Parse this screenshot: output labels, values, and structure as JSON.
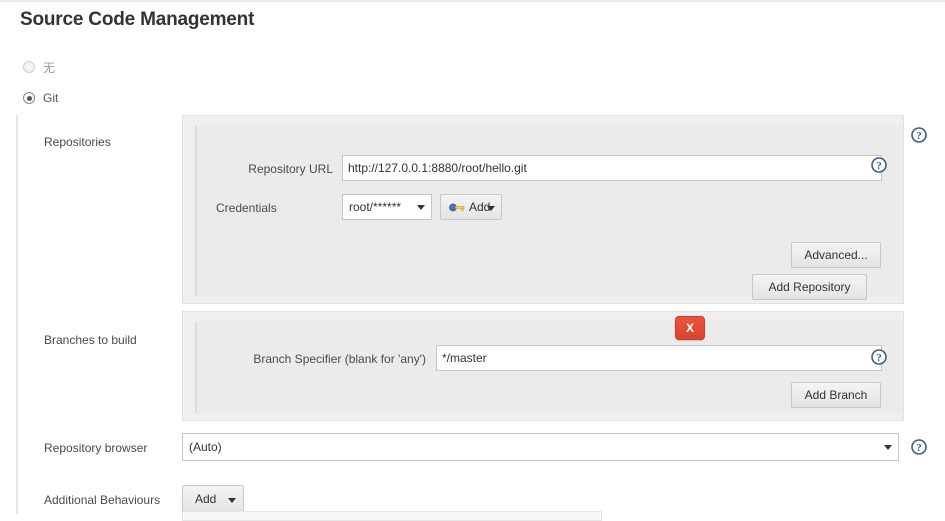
{
  "page": {
    "section_title": "Source Code Management"
  },
  "scm_options": [
    {
      "label": "无",
      "selected": false,
      "disabled": true
    },
    {
      "label": "Git",
      "selected": true,
      "disabled": false
    }
  ],
  "repositories": {
    "row_label": "Repositories",
    "repository_url": {
      "label": "Repository URL",
      "value": "http://127.0.0.1:8880/root/hello.git",
      "placeholder": ""
    },
    "credentials": {
      "label": "Credentials",
      "selected": "root/******",
      "add_button": "Add",
      "add_icon": "key-icon"
    },
    "advanced_button": "Advanced...",
    "add_repository_button": "Add Repository"
  },
  "branches": {
    "row_label": "Branches to build",
    "branch_specifier": {
      "label": "Branch Specifier (blank for 'any')",
      "value": "*/master",
      "placeholder": ""
    },
    "delete_button": "X",
    "add_branch_button": "Add Branch"
  },
  "repository_browser": {
    "row_label": "Repository browser",
    "selected": "(Auto)"
  },
  "additional_behaviours": {
    "row_label": "Additional Behaviours",
    "add_button": "Add"
  },
  "icons": {
    "help": "help-icon",
    "caret_down": "chevron-down-icon"
  },
  "colors": {
    "delete_red": "#d9452f",
    "help_blue": "#3c5a8c",
    "panel_grey": "#ebebeb",
    "page_white": "#ffffff"
  }
}
